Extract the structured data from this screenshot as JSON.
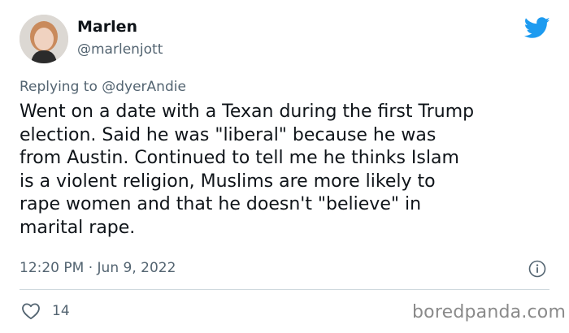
{
  "author": {
    "display_name": "Marlen",
    "handle": "@marlenjott",
    "avatar_icon": "profile-photo"
  },
  "reply": {
    "prefix": "Replying to",
    "mention": "@dyerAndie"
  },
  "tweet": {
    "lines": [
      "Went on a date with a Texan during the first Trump",
      "election. Said he was \"liberal\" because he was",
      "from Austin. Continued to tell me he thinks Islam",
      "is a violent religion, Muslims are more likely to",
      "rape women and that he doesn't \"believe\" in",
      "marital rape."
    ],
    "time": "12:20 PM",
    "separator": "·",
    "date": "Jun 9, 2022"
  },
  "engagement": {
    "like_count": "14"
  },
  "watermark": "boredpanda.com",
  "colors": {
    "twitter_blue": "#1d9bf0",
    "secondary_text": "#536471",
    "divider": "#cfd9de"
  }
}
